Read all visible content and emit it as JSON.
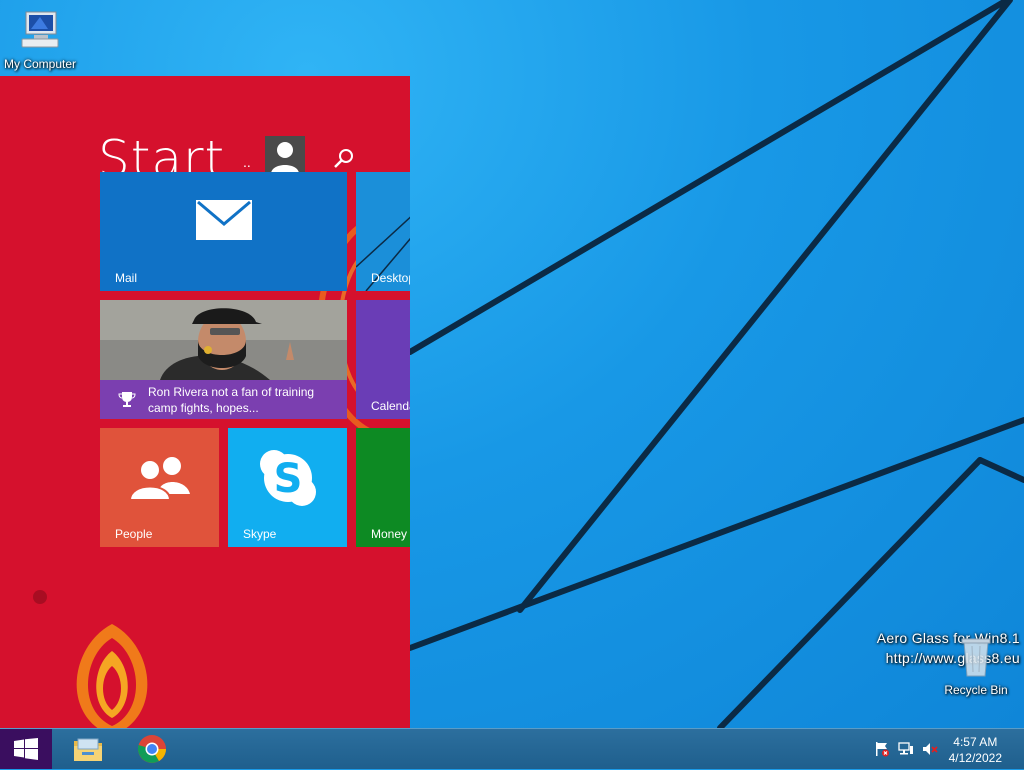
{
  "desktop": {
    "my_computer_label": "My Computer",
    "recycle_bin_label": "Recycle Bin",
    "watermark_line1": "Aero Glass for Win8.1",
    "watermark_line2": "http://www.glass8.eu"
  },
  "start": {
    "title": "Start",
    "user_dots": "..",
    "icons": {
      "user": "user-avatar-icon",
      "search": "search-icon"
    },
    "tiles": {
      "mail": {
        "label": "Mail",
        "icon": "mail-envelope-icon"
      },
      "desktop": {
        "label": "Desktop"
      },
      "news": {
        "headline": "Ron Rivera not a fan of training camp fights, hopes...",
        "icon": "trophy-icon"
      },
      "calendar": {
        "label": "Calenda"
      },
      "people": {
        "label": "People",
        "icon": "people-icon"
      },
      "skype": {
        "label": "Skype",
        "icon": "skype-icon"
      },
      "money": {
        "label": "Money"
      }
    }
  },
  "taskbar": {
    "start_icon": "windows-logo-icon",
    "apps": [
      "file-explorer-icon",
      "chrome-icon"
    ],
    "tray": [
      "action-center-flag-icon",
      "network-icon",
      "volume-muted-icon"
    ],
    "time": "4:57 AM",
    "date": "4/12/2022"
  },
  "colors": {
    "start_bg": "#d5112d",
    "desktop_bg": "#1a9be8",
    "mail_tile": "#1072c6",
    "skype_tile": "#11aef0",
    "people_tile": "#e0533b",
    "money_tile": "#0d8a23",
    "news_bar": "#7b3fb0"
  }
}
